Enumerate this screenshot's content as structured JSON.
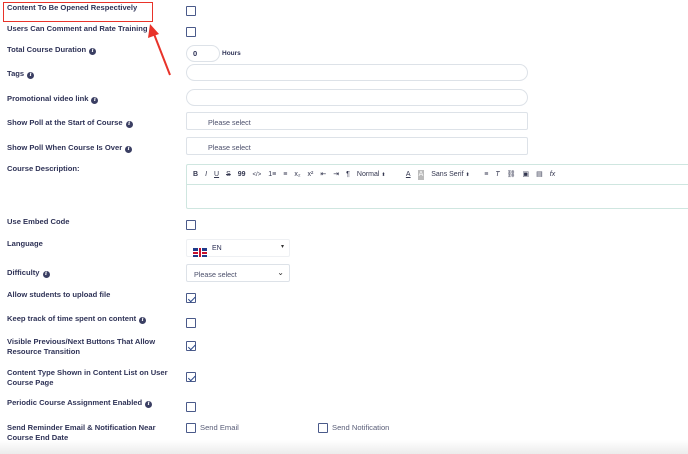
{
  "fields": {
    "content_opened": "Content To Be Opened Respectively",
    "comment_rate": "Users Can Comment and Rate Training",
    "total_duration": "Total Course Duration",
    "duration_value": "0",
    "duration_unit": "Hours",
    "tags": "Tags",
    "promo_video": "Promotional video link",
    "poll_start": "Show Poll at the Start of Course",
    "poll_over": "Show Poll When Course Is Over",
    "poll_placeholder": "Please select",
    "description": "Course Description:",
    "embed_code": "Use Embed Code",
    "language": "Language",
    "language_value": "EN",
    "difficulty": "Difficulty",
    "difficulty_placeholder": "Please select",
    "upload_file": "Allow students to upload file",
    "track_time": "Keep track of time spent on content",
    "prev_next": "Visible Previous/Next Buttons That Allow Resource Transition",
    "content_type": "Content Type Shown in Content List on User Course Page",
    "periodic": "Periodic Course Assignment Enabled",
    "reminder": "Send Reminder Email & Notification Near Course End Date",
    "send_email": "Send Email",
    "send_notification": "Send Notification"
  },
  "editor_toolbar": {
    "bold": "B",
    "italic": "I",
    "underline": "U",
    "strike": "S",
    "quote": "99",
    "code": "</>",
    "ordered_list": "1≡",
    "bullet_list": "≡",
    "subscript": "x₂",
    "superscript": "x²",
    "outdent": "⇤",
    "indent": "⇥",
    "rtl": "¶",
    "header": "Normal",
    "font": "Sans Serif",
    "color": "A",
    "background": "A",
    "align": "≡",
    "clean": "T",
    "link": "⛓",
    "image": "▣",
    "video": "▤",
    "formula": "fx"
  },
  "checkboxes": {
    "content_opened": false,
    "comment_rate": false,
    "embed_code": false,
    "upload_file": true,
    "track_time": false,
    "prev_next": true,
    "content_type": true,
    "periodic": false,
    "send_email": false,
    "send_notification": false
  },
  "colors": {
    "annotation": "#e8332a",
    "label": "#2f3357",
    "border": "#dde2e8",
    "check": "#2c4a8a"
  }
}
